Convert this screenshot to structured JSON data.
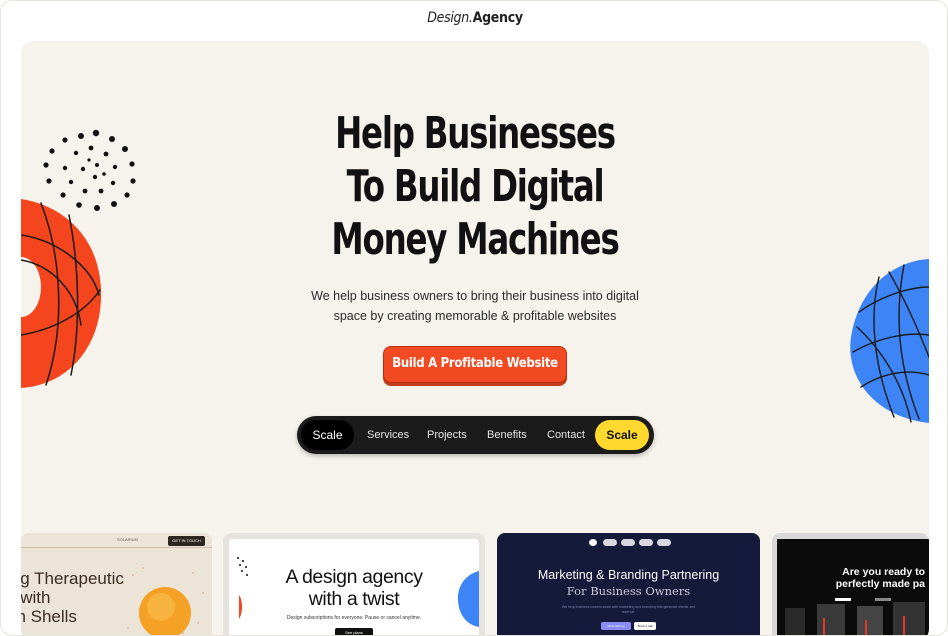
{
  "brand": {
    "logo_part1": "Design.",
    "logo_part2": "Agency"
  },
  "hero": {
    "headline": [
      "Help Businesses",
      "To Build Digital",
      "Money Machines"
    ],
    "subtext": [
      "We help business owners to bring their business into digital",
      "space by creating memorable & profitable websites"
    ],
    "cta_label": "Build A Profitable Website"
  },
  "nav": {
    "left_label": "Scale",
    "items": [
      "Services",
      "Projects",
      "Benefits",
      "Contact"
    ],
    "right_label": "Scale"
  },
  "cards": [
    {
      "title_lines": [
        "ing Therapeutic",
        "y with",
        "on Shells"
      ],
      "button": "GET IN TOUCH",
      "logo": "SOLARIUM"
    },
    {
      "title_lines": [
        "A design agency",
        "with a twist"
      ],
      "sub": "Design subscriptions for everyone. Pause or cancel anytime.",
      "button": "See plans"
    },
    {
      "title": "Marketing & Branding Partnering",
      "subtitle": "For Business Owners",
      "desc": "We help business owners scale with marketing and branding that generate clients and revenue.",
      "button_primary": "Work with us",
      "button_secondary": "Book a call"
    },
    {
      "title_lines": [
        "Are you ready to",
        "perfectly made pa"
      ]
    }
  ],
  "colors": {
    "hero_bg": "#f6f3ec",
    "cta": "#f24a23",
    "nav_bg": "#1b1b1b",
    "nav_highlight": "#ffd92e",
    "blob_red": "#f4451e",
    "blob_blue": "#3d84f6"
  }
}
